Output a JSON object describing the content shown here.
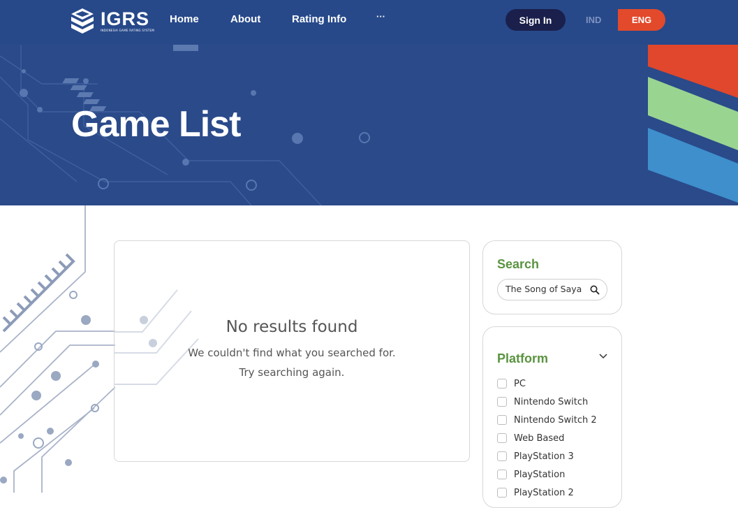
{
  "header": {
    "logo_text": "IGRS",
    "logo_subtitle": "INDONESIA GAME RATING SYSTEM",
    "nav": [
      {
        "label": "Home"
      },
      {
        "label": "About"
      },
      {
        "label": "Rating Info"
      },
      {
        "label": "···"
      }
    ],
    "sign_in_label": "Sign In",
    "lang_ind": "IND",
    "lang_eng": "ENG"
  },
  "hero": {
    "title": "Game List",
    "stripe_colors": [
      "#e0472c",
      "#9ad491",
      "#3e8fcc"
    ]
  },
  "results": {
    "title": "No results found",
    "line1": "We couldn't find what you searched for.",
    "line2": "Try searching again."
  },
  "search": {
    "heading": "Search",
    "value": "The Song of Saya",
    "icon": "search-icon"
  },
  "platform": {
    "heading": "Platform",
    "icon": "chevron-down-icon",
    "items": [
      {
        "label": "PC"
      },
      {
        "label": "Nintendo Switch"
      },
      {
        "label": "Nintendo Switch 2"
      },
      {
        "label": "Web Based"
      },
      {
        "label": "PlayStation 3"
      },
      {
        "label": "PlayStation"
      },
      {
        "label": "PlayStation 2"
      }
    ]
  },
  "colors": {
    "brand_blue": "#27498a",
    "accent_green": "#5a9340",
    "accent_red": "#e24a2b",
    "sign_in_bg": "#1a1f4b"
  }
}
